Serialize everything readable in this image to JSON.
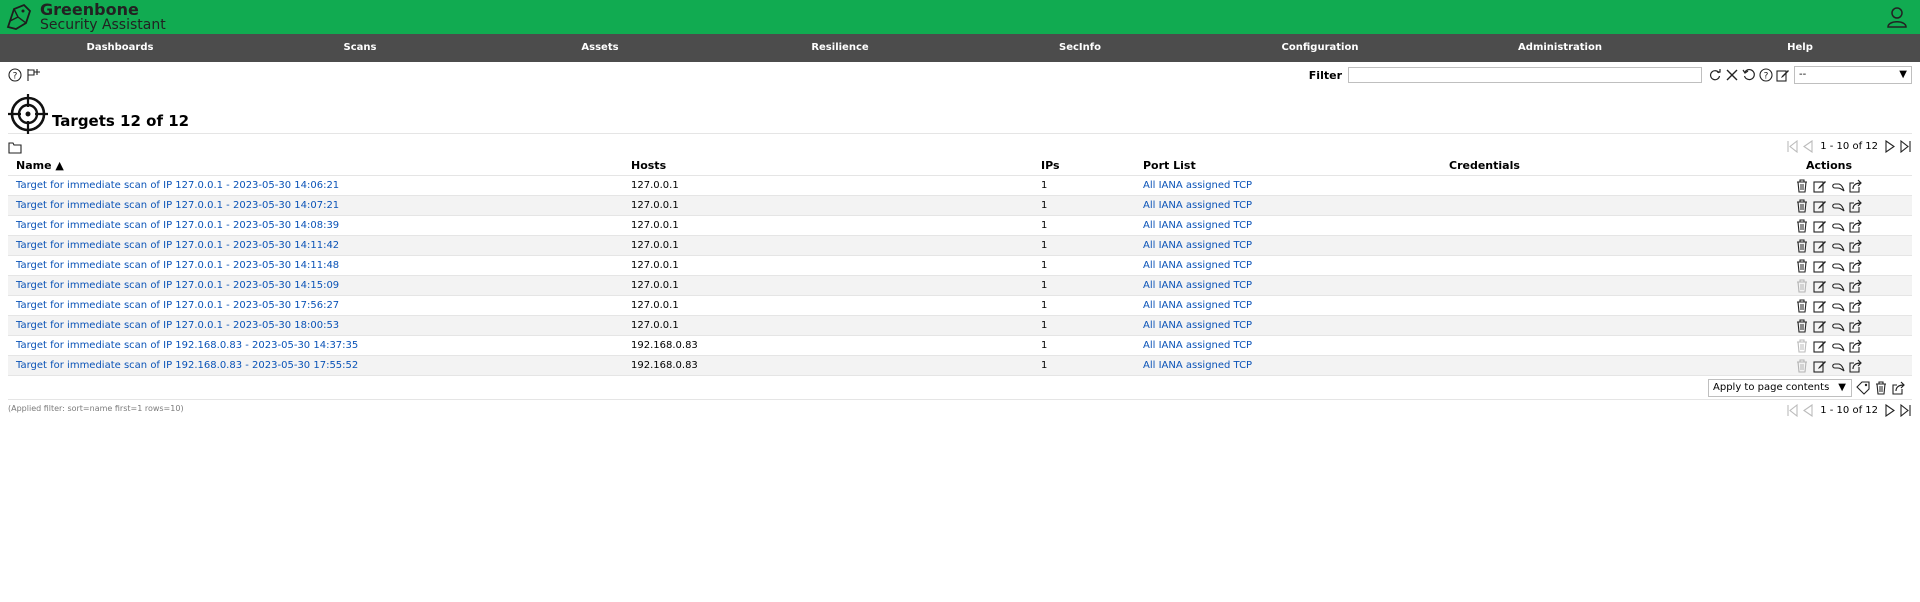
{
  "header": {
    "logo_title": "Greenbone",
    "logo_subtitle": "Security Assistant",
    "user_icon": "user-icon"
  },
  "nav": [
    "Dashboards",
    "Scans",
    "Assets",
    "Resilience",
    "SecInfo",
    "Configuration",
    "Administration",
    "Help"
  ],
  "filter": {
    "label": "Filter",
    "value": "",
    "select_value": "--"
  },
  "page": {
    "title": "Targets 12 of 12"
  },
  "pagination": {
    "text": "1 - 10 of 12"
  },
  "table": {
    "columns": [
      "Name ▲",
      "Hosts",
      "IPs",
      "Port List",
      "Credentials",
      "Actions"
    ],
    "rows": [
      {
        "name": "Target for immediate scan of IP 127.0.0.1 - 2023-05-30 14:06:21",
        "hosts": "127.0.0.1",
        "ips": "1",
        "port_list": "All IANA assigned TCP",
        "credentials": "",
        "delete_enabled": true
      },
      {
        "name": "Target for immediate scan of IP 127.0.0.1 - 2023-05-30 14:07:21",
        "hosts": "127.0.0.1",
        "ips": "1",
        "port_list": "All IANA assigned TCP",
        "credentials": "",
        "delete_enabled": true
      },
      {
        "name": "Target for immediate scan of IP 127.0.0.1 - 2023-05-30 14:08:39",
        "hosts": "127.0.0.1",
        "ips": "1",
        "port_list": "All IANA assigned TCP",
        "credentials": "",
        "delete_enabled": true
      },
      {
        "name": "Target for immediate scan of IP 127.0.0.1 - 2023-05-30 14:11:42",
        "hosts": "127.0.0.1",
        "ips": "1",
        "port_list": "All IANA assigned TCP",
        "credentials": "",
        "delete_enabled": true
      },
      {
        "name": "Target for immediate scan of IP 127.0.0.1 - 2023-05-30 14:11:48",
        "hosts": "127.0.0.1",
        "ips": "1",
        "port_list": "All IANA assigned TCP",
        "credentials": "",
        "delete_enabled": true
      },
      {
        "name": "Target for immediate scan of IP 127.0.0.1 - 2023-05-30 14:15:09",
        "hosts": "127.0.0.1",
        "ips": "1",
        "port_list": "All IANA assigned TCP",
        "credentials": "",
        "delete_enabled": false
      },
      {
        "name": "Target for immediate scan of IP 127.0.0.1 - 2023-05-30 17:56:27",
        "hosts": "127.0.0.1",
        "ips": "1",
        "port_list": "All IANA assigned TCP",
        "credentials": "",
        "delete_enabled": true
      },
      {
        "name": "Target for immediate scan of IP 127.0.0.1 - 2023-05-30 18:00:53",
        "hosts": "127.0.0.1",
        "ips": "1",
        "port_list": "All IANA assigned TCP",
        "credentials": "",
        "delete_enabled": true
      },
      {
        "name": "Target for immediate scan of IP 192.168.0.83 - 2023-05-30 14:37:35",
        "hosts": "192.168.0.83",
        "ips": "1",
        "port_list": "All IANA assigned TCP",
        "credentials": "",
        "delete_enabled": false
      },
      {
        "name": "Target for immediate scan of IP 192.168.0.83 - 2023-05-30 17:55:52",
        "hosts": "192.168.0.83",
        "ips": "1",
        "port_list": "All IANA assigned TCP",
        "credentials": "",
        "delete_enabled": false
      }
    ]
  },
  "bulk": {
    "select_value": "Apply to page contents"
  },
  "applied_filter": "(Applied filter: sort=name first=1 rows=10)",
  "colors": {
    "header_green": "#11ab51",
    "nav_grey": "#4c4c4c",
    "link_blue": "#0a53b7"
  }
}
